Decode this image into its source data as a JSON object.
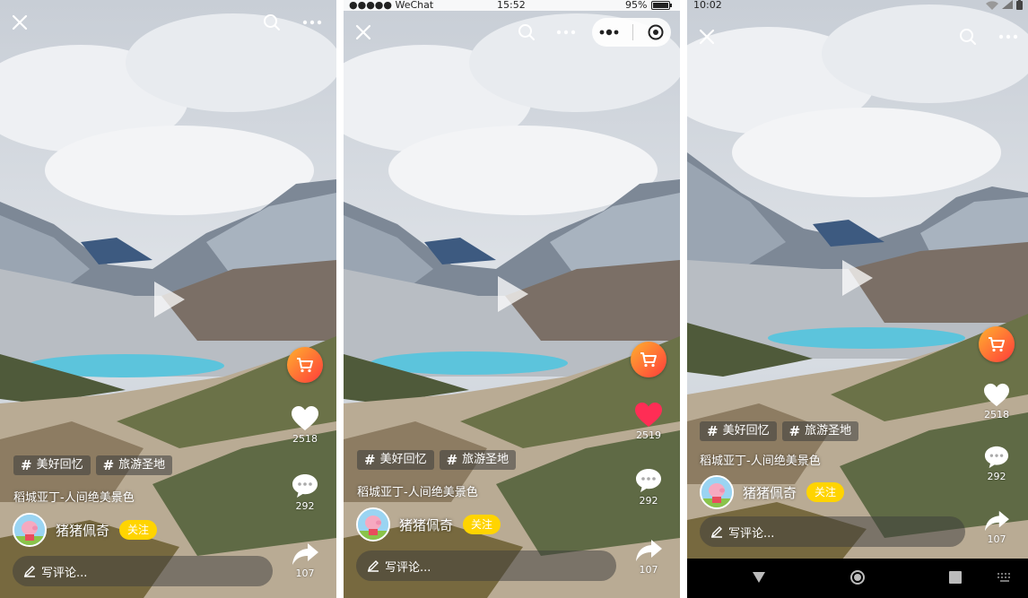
{
  "colors": {
    "cart_gradient_start": "#ffb02e",
    "cart_gradient_end": "#ff3b3b",
    "follow_bg": "#ffd400",
    "liked_heart": "#ff2d55",
    "lake": "#5cc4dc"
  },
  "icons": {
    "close": "close-icon",
    "search": "search-icon",
    "more": "more-icon",
    "cart": "cart-icon",
    "like": "heart-icon",
    "comment": "comment-bubble-icon",
    "share": "share-icon",
    "edit": "pencil-icon",
    "play": "play-icon"
  },
  "screens": [
    {
      "tags": [
        "美好回忆",
        "旅游圣地"
      ],
      "video_title": "稻城亚丁-人间绝美景色",
      "username": "猪猪佩奇",
      "follow_label": "关注",
      "comment_placeholder": "写评论...",
      "likes": "2518",
      "comments": "292",
      "shares": "107"
    },
    {
      "status": {
        "carrier": "●●●●● WeChat",
        "time": "15:52",
        "battery": "95%"
      },
      "tags": [
        "美好回忆",
        "旅游圣地"
      ],
      "video_title": "稻城亚丁-人间绝美景色",
      "username": "猪猪佩奇",
      "follow_label": "关注",
      "comment_placeholder": "写评论...",
      "likes": "2519",
      "comments": "292",
      "shares": "107",
      "liked": true
    },
    {
      "status": {
        "time": "10:02"
      },
      "tags": [
        "美好回忆",
        "旅游圣地"
      ],
      "video_title": "稻城亚丁-人间绝美景色",
      "username": "猪猪佩奇",
      "follow_label": "关注",
      "comment_placeholder": "写评论...",
      "likes": "2518",
      "comments": "292",
      "shares": "107"
    }
  ]
}
